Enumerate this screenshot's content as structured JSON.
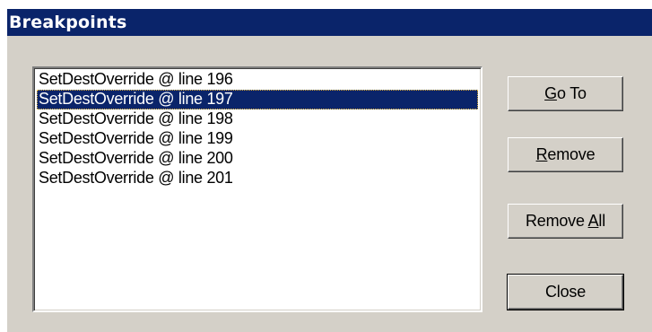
{
  "window": {
    "title": "Breakpoints"
  },
  "breakpoints": {
    "items": [
      "SetDestOverride @ line 196",
      "SetDestOverride @ line 197",
      "SetDestOverride @ line 198",
      "SetDestOverride @ line 199",
      "SetDestOverride @ line 200",
      "SetDestOverride @ line 201"
    ],
    "selected_index": 1
  },
  "buttons": {
    "goto": {
      "mnemonic": "G",
      "rest": "o To"
    },
    "remove": {
      "mnemonic": "R",
      "rest": "emove"
    },
    "remove_all": {
      "prefix": "Remove ",
      "mnemonic": "A",
      "rest": "ll"
    },
    "close": {
      "label": "Close"
    }
  }
}
